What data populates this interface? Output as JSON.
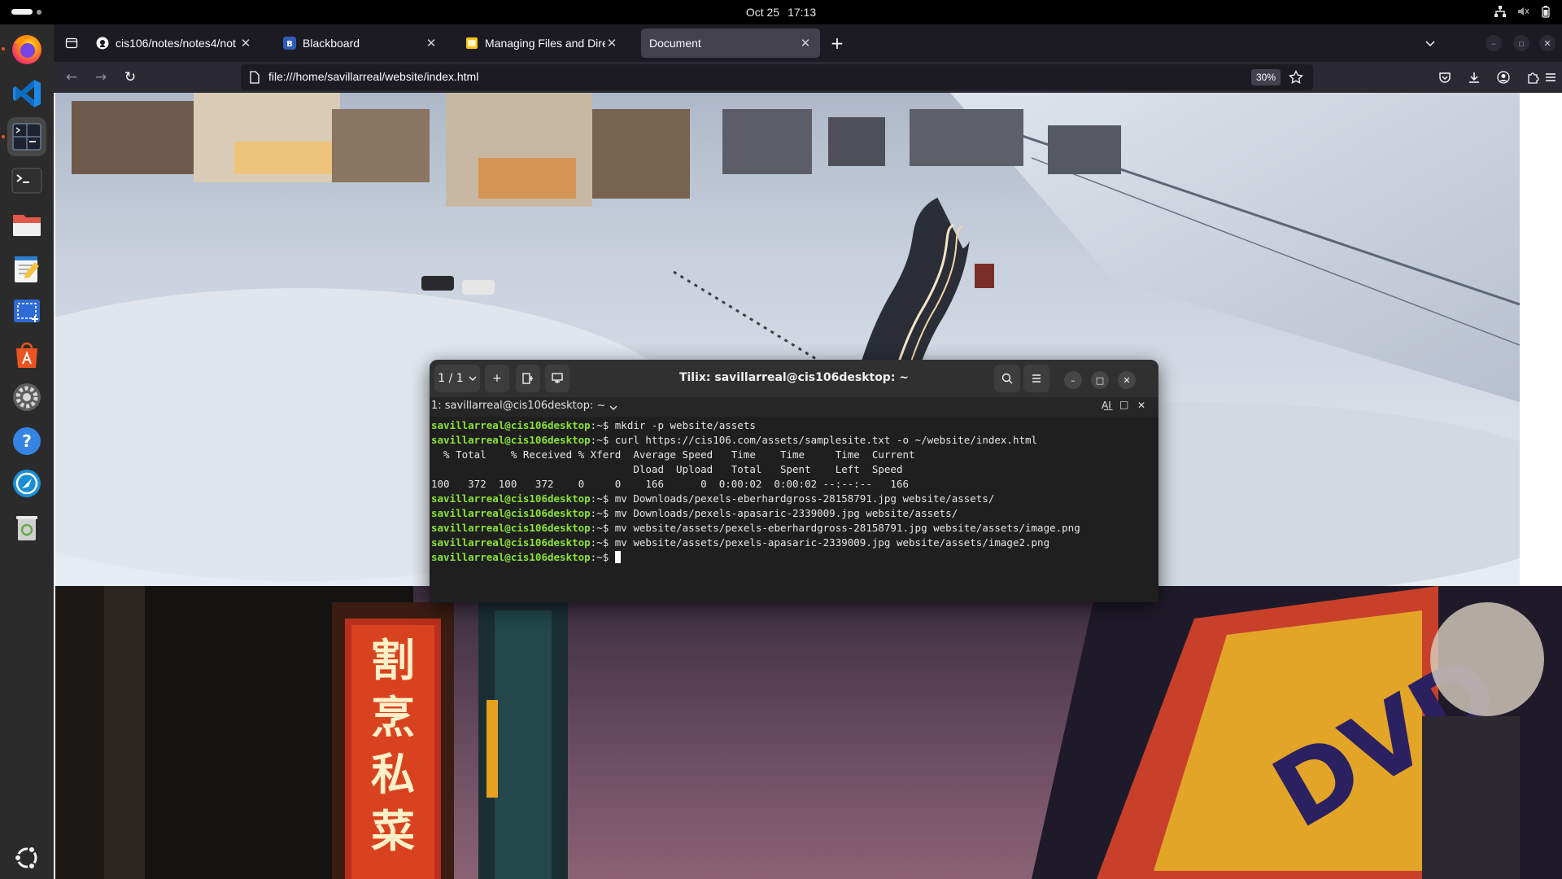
{
  "topbar": {
    "date": "Oct 25",
    "time": "17:13",
    "tray_icons": [
      "network-icon",
      "volume-muted-icon",
      "battery-icon"
    ]
  },
  "dock": {
    "items": [
      {
        "name": "firefox",
        "icon": "firefox-icon",
        "running": true
      },
      {
        "name": "vscode",
        "icon": "vscode-icon",
        "running": false
      },
      {
        "name": "tilix",
        "icon": "tilix-icon",
        "running": true
      },
      {
        "name": "terminal",
        "icon": "terminal-icon",
        "running": false
      },
      {
        "name": "files",
        "icon": "files-icon",
        "running": false
      },
      {
        "name": "text-editor",
        "icon": "text-editor-icon",
        "running": false
      },
      {
        "name": "screenshot",
        "icon": "screenshot-icon",
        "running": false
      },
      {
        "name": "app-center",
        "icon": "app-center-icon",
        "running": false
      },
      {
        "name": "settings",
        "icon": "settings-icon",
        "running": false
      },
      {
        "name": "help",
        "icon": "help-icon",
        "running": false
      },
      {
        "name": "remmina",
        "icon": "remote-desktop-icon",
        "running": false
      },
      {
        "name": "trash",
        "icon": "trash-icon",
        "running": false
      },
      {
        "name": "show-apps",
        "icon": "ubuntu-apps-icon",
        "running": false
      }
    ]
  },
  "browser": {
    "tabs": [
      {
        "title": "cis106/notes/notes4/not",
        "favicon": "github-icon",
        "selected": false
      },
      {
        "title": "Blackboard",
        "favicon": "blackboard-icon",
        "selected": false
      },
      {
        "title": "Managing Files and Direc",
        "favicon": "doc-icon",
        "selected": false
      },
      {
        "title": "Document",
        "favicon": "",
        "selected": true
      }
    ],
    "new_tab_label": "+",
    "url": "file:///home/savillarreal/website/index.html",
    "zoom": "30%",
    "colors": {
      "chrome": "#1c1b22",
      "toolbar": "#2b2a33",
      "selected_tab": "#42414d"
    }
  },
  "tilix": {
    "session_button": "1 / 1",
    "title": "Tilix: savillarreal@cis106desktop: ~",
    "session_title": "1: savillarreal@cis106desktop: ~",
    "prompt": "savillarreal@cis106desktop",
    "prompt_suffix": ":~$ ",
    "lines": [
      {
        "type": "cmd",
        "text": "mkdir -p website/assets"
      },
      {
        "type": "cmd",
        "text": "curl https://cis106.com/assets/samplesite.txt -o ~/website/index.html"
      },
      {
        "type": "out",
        "text": "  % Total    % Received % Xferd  Average Speed   Time    Time     Time  Current"
      },
      {
        "type": "out",
        "text": "                                 Dload  Upload   Total   Spent    Left  Speed"
      },
      {
        "type": "out",
        "text": "100   372  100   372    0     0    166      0  0:00:02  0:00:02 --:--:--   166"
      },
      {
        "type": "cmd",
        "text": "mv Downloads/pexels-eberhardgross-28158791.jpg website/assets/"
      },
      {
        "type": "cmd",
        "text": "mv Downloads/pexels-apasaric-2339009.jpg website/assets/"
      },
      {
        "type": "cmd",
        "text": "mv website/assets/pexels-eberhardgross-28158791.jpg website/assets/image.png"
      },
      {
        "type": "cmd",
        "text": "mv website/assets/pexels-apasaric-2339009.jpg website/assets/image2.png"
      },
      {
        "type": "cmd",
        "text": ""
      }
    ],
    "colors": {
      "prompt": "#8ae234",
      "background": "#1f1f1f",
      "header": "#303030"
    }
  }
}
